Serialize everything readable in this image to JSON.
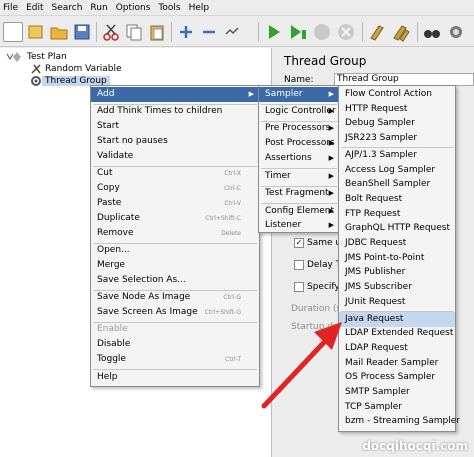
{
  "menubar": {
    "items": [
      "File",
      "Edit",
      "Search",
      "Run",
      "Options",
      "Tools",
      "Help"
    ]
  },
  "toolbar": {
    "buttons": [
      "new-icon",
      "templates-icon",
      "open-icon",
      "save-icon",
      "cut-icon",
      "copy-icon",
      "paste-icon",
      "expand-icon",
      "collapse-icon",
      "toggle-icon",
      "start-icon",
      "start-no-pauses-icon",
      "stop-icon",
      "shutdown-icon",
      "clear-icon",
      "clear-all-icon",
      "search-icon",
      "help-icon"
    ]
  },
  "tree": {
    "root": "Test Plan",
    "child1": "Random Variable",
    "child2": "Thread Group"
  },
  "panel": {
    "title": "Thread Group",
    "name_label": "Name:",
    "name_value": "Thread Group",
    "same_user": "Same u",
    "delay": "Delay T",
    "specify": "Specify",
    "duration": "Duration (s",
    "startup": "Startup del"
  },
  "ctx": {
    "add": "Add",
    "add_think": "Add Think Times to children",
    "start": "Start",
    "start_np": "Start no pauses",
    "validate": "Validate",
    "cut": "Cut",
    "cut_sc": "Ctrl-X",
    "copy": "Copy",
    "copy_sc": "Ctrl-C",
    "paste": "Paste",
    "paste_sc": "Ctrl-V",
    "duplicate": "Duplicate",
    "duplicate_sc": "Ctrl+Shift-C",
    "remove": "Remove",
    "remove_sc": "Delete",
    "open": "Open...",
    "merge": "Merge",
    "save_sel": "Save Selection As...",
    "save_node": "Save Node As Image",
    "save_node_sc": "Ctrl-G",
    "save_screen": "Save Screen As Image",
    "save_screen_sc": "Ctrl+Shift-G",
    "enable": "Enable",
    "disable": "Disable",
    "toggle": "Toggle",
    "toggle_sc": "Ctrl-T",
    "help": "Help"
  },
  "addmenu": {
    "sampler": "Sampler",
    "logic": "Logic Controller",
    "pre": "Pre Processors",
    "post": "Post Processors",
    "assertions": "Assertions",
    "timer": "Timer",
    "fragment": "Test Fragment",
    "config": "Config Element",
    "listener": "Listener"
  },
  "samplers": [
    "Flow Control Action",
    "HTTP Request",
    "Debug Sampler",
    "JSR223 Sampler",
    "AJP/1.3 Sampler",
    "Access Log Sampler",
    "BeanShell Sampler",
    "Bolt Request",
    "FTP Request",
    "GraphQL HTTP Request",
    "JDBC Request",
    "JMS Point-to-Point",
    "JMS Publisher",
    "JMS Subscriber",
    "JUnit Request",
    "Java Request",
    "LDAP Extended Request",
    "LDAP Request",
    "Mail Reader Sampler",
    "OS Process Sampler",
    "SMTP Sampler",
    "TCP Sampler",
    "bzm - Streaming Sampler"
  ],
  "watermark": "docqihocqi.com",
  "colors": {
    "highlight": "#3c6aa7",
    "arrow": "#e02424"
  }
}
